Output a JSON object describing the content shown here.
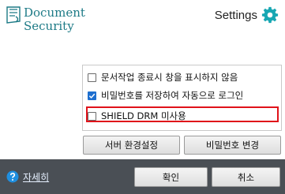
{
  "header": {
    "logo_line1": "Document",
    "logo_line2": "Security",
    "settings_label": "Settings"
  },
  "options": [
    {
      "label": "문서작업 종료시 창을 표시하지 않음",
      "checked": false
    },
    {
      "label": "비밀번호를 저장하여 자동으로 로그인",
      "checked": true
    },
    {
      "label": "SHIELD DRM 미사용",
      "checked": false,
      "highlighted": true
    }
  ],
  "buttons": {
    "server_settings": "서버 환경설정",
    "change_password": "비밀번호 변경"
  },
  "footer": {
    "help_label": "자세히",
    "ok_label": "확인",
    "cancel_label": "취소"
  },
  "colors": {
    "brand": "#1d7a86",
    "gear": "#17a7b3",
    "footer_bg": "#4a4f55",
    "highlight": "#e0121a",
    "checkbox_checked": "#1e6fcf"
  },
  "icons": [
    "document-security-logo-icon",
    "gear-icon",
    "help-icon",
    "check-icon"
  ]
}
